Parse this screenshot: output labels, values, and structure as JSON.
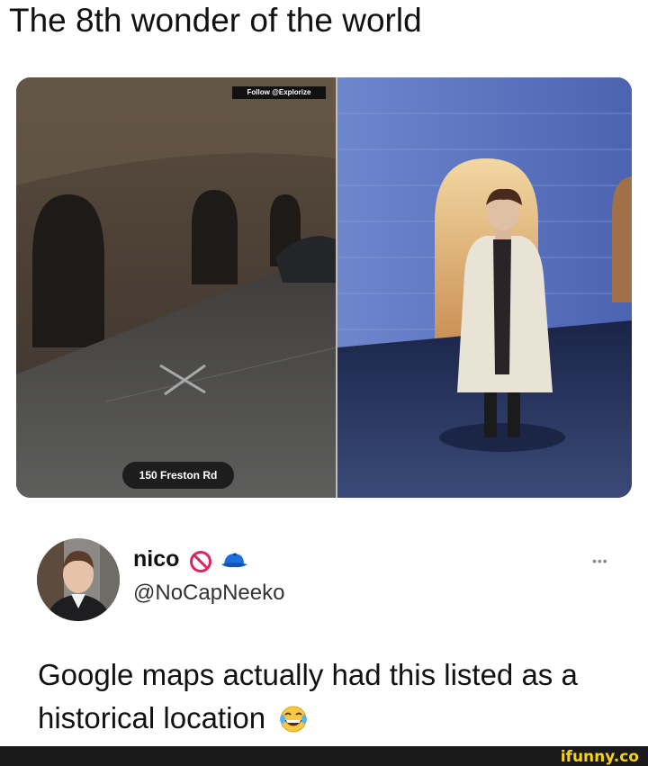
{
  "meme": {
    "title": "The 8th wonder of the world"
  },
  "photo": {
    "follow_tag": "Follow @Explorize",
    "location_pill": "150 Freston Rd"
  },
  "tweet": {
    "display_name": "nico",
    "handle": "@NoCapNeeko",
    "more_label": "•••",
    "text": "Google maps actually had this listed as a historical location",
    "icons": [
      "blocked-icon",
      "blue-cap-icon",
      "laughing-emoji-icon",
      "more-options-icon"
    ]
  },
  "footer": {
    "watermark": "ifunny.co"
  },
  "colors": {
    "background": "#ffffff",
    "text": "#111111",
    "watermark": "#f5d21a",
    "footer": "#1a1a1a",
    "blocked_red": "#e0245e",
    "cap_blue": "#1d6fe0"
  }
}
